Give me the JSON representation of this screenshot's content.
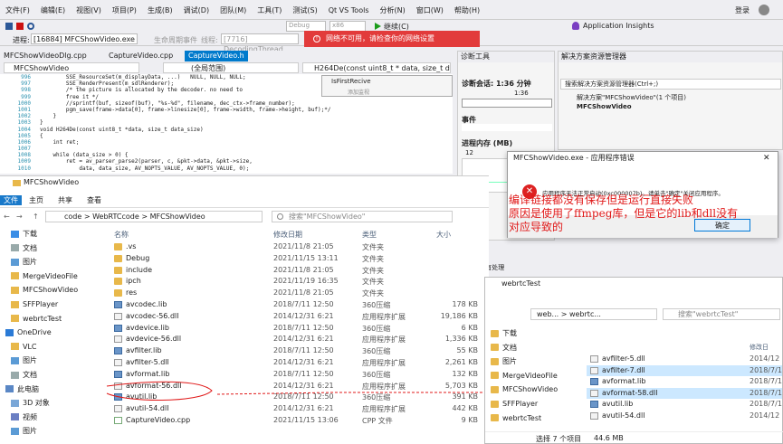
{
  "vs": {
    "menu": [
      "文件(F)",
      "编辑(E)",
      "视图(V)",
      "项目(P)",
      "生成(B)",
      "调试(D)",
      "团队(M)",
      "工具(T)",
      "测试(S)",
      "Qt VS Tools",
      "分析(N)",
      "窗口(W)",
      "帮助(H)"
    ],
    "login": "登录",
    "toolbar": {
      "config": "Debug",
      "platform": "x86",
      "continue": "继续(C)",
      "app_insights": "Application Insights"
    },
    "process_label": "进程:",
    "process_value": "[16884] MFCShowVideo.exe",
    "lifecycle": "生命周期事件",
    "thread_label": "线程:",
    "thread_value": "[7716] DecodingThread",
    "network_banner": "网络不可用，请检查你的网络设置",
    "tabs": [
      "MFCShowVideoDlg.cpp",
      "CaptureVideo.cpp",
      "CaptureVideo.h"
    ],
    "scope": "MFCShowVideo",
    "scope2": "(全局范围)",
    "func": "H264De(const uint8_t * data, size_t data_s",
    "code_lines": [
      {
        "num": "996",
        "text": "        SSE_ResourceSet(m_displayData, ...)   NULL, NULL, NULL;"
      },
      {
        "num": "997",
        "text": "        SSE_RenderPresent(m_sdlRenderer);"
      },
      {
        "num": "998",
        "text": "        /* the picture is allocated by the decoder. no need to"
      },
      {
        "num": "999",
        "text": "        free it */"
      },
      {
        "num": "1000",
        "text": "        //sprintf(buf, sizeof(buf), \"%s-%d\", filename, dec_ctx->frame_number);"
      },
      {
        "num": "1001",
        "text": "        pgm_save(frame->data[0], frame->linesize[0], frame->width, frame->height, buf);*/"
      },
      {
        "num": "1002",
        "text": "    }"
      },
      {
        "num": "1003",
        "text": "}"
      },
      {
        "num": "1004",
        "text": "void H264De(const uint8_t *data, size_t data_size)"
      },
      {
        "num": "1005",
        "text": "{"
      },
      {
        "num": "1006",
        "text": "    int ret;"
      },
      {
        "num": "1007",
        "text": ""
      },
      {
        "num": "1008",
        "text": "    while (data_size > 0) {"
      },
      {
        "num": "1009",
        "text": "        ret = av_parser_parse2(parser, c, &pkt->data, &pkt->size,"
      },
      {
        "num": "1010",
        "text": "            data, data_size, AV_NOPTS_VALUE, AV_NOPTS_VALUE, 0);"
      }
    ],
    "popup_title": "IsFirstRecive",
    "popup_sub": "添加监视",
    "diag": {
      "title": "诊断工具",
      "session": "诊断会话: 1:36 分钟",
      "tick": "1:36",
      "events": "事件",
      "memory": "进程内存 (MB)",
      "mem_val": "12",
      "mem_val2": "0",
      "cpu": "CPU (所有处理",
      "snap": "快照",
      "use": "使用",
      "small": "最小大小(堆)"
    },
    "sol": {
      "title": "解决方案资源管理器",
      "search": "搜索解决方案资源管理器(Ctrl+;)",
      "item1": "解决方案\"MFCShowVideo\"(1 个项目)",
      "item2": "MFCShowVideo"
    }
  },
  "error": {
    "title": "MFCShowVideo.exe - 应用程序错误",
    "message": "应用程序无法正常启动(0xc000007b)。请单击\"确定\"关闭应用程序。",
    "ok": "确定"
  },
  "annotation": {
    "line1": "编译链接都没有保存但是运行直接失败",
    "line2": "原因是使用了ffmpeg库，但是它的lib和dll没有",
    "line3": "对应导致的"
  },
  "exp1": {
    "title": "MFCShowVideo",
    "ribbon": [
      "文件",
      "主页",
      "共享",
      "查看"
    ],
    "breadcrumb": [
      "code",
      "WebRTCcode",
      "MFCShowVideo"
    ],
    "search": "搜索\"MFCShowVideo\"",
    "headers": {
      "name": "名称",
      "date": "修改日期",
      "type": "类型",
      "size": "大小"
    },
    "nav": [
      {
        "label": "下载",
        "icon": "download-icon"
      },
      {
        "label": "文档",
        "icon": "document-icon"
      },
      {
        "label": "图片",
        "icon": "picture-icon"
      },
      {
        "label": "MergeVideoFile",
        "icon": "folder-icon"
      },
      {
        "label": "MFCShowVideo",
        "icon": "folder-icon"
      },
      {
        "label": "SFFPlayer",
        "icon": "folder-icon"
      },
      {
        "label": "webrtcTest",
        "icon": "folder-icon"
      },
      {
        "label": "OneDrive",
        "icon": "cloud-icon"
      },
      {
        "label": "VLC",
        "icon": "folder-icon"
      },
      {
        "label": "图片",
        "icon": "picture-icon"
      },
      {
        "label": "文档",
        "icon": "document-icon"
      },
      {
        "label": "此电脑",
        "icon": "pc-icon"
      },
      {
        "label": "3D 对象",
        "icon": "cube-icon"
      },
      {
        "label": "视频",
        "icon": "video-icon"
      },
      {
        "label": "图片",
        "icon": "picture-icon"
      }
    ],
    "files": [
      {
        "name": ".vs",
        "date": "2021/11/8 21:05",
        "type": "文件夹",
        "size": "",
        "kind": "folder"
      },
      {
        "name": "Debug",
        "date": "2021/11/15 13:11",
        "type": "文件夹",
        "size": "",
        "kind": "folder"
      },
      {
        "name": "include",
        "date": "2021/11/8 21:05",
        "type": "文件夹",
        "size": "",
        "kind": "folder"
      },
      {
        "name": "ipch",
        "date": "2021/11/19 16:35",
        "type": "文件夹",
        "size": "",
        "kind": "folder"
      },
      {
        "name": "res",
        "date": "2021/11/8 21:05",
        "type": "文件夹",
        "size": "",
        "kind": "folder"
      },
      {
        "name": "avcodec.lib",
        "date": "2018/7/11 12:50",
        "type": "360压缩",
        "size": "178 KB",
        "kind": "lib"
      },
      {
        "name": "avcodec-56.dll",
        "date": "2014/12/31 6:21",
        "type": "应用程序扩展",
        "size": "19,186 KB",
        "kind": "dll"
      },
      {
        "name": "avdevice.lib",
        "date": "2018/7/11 12:50",
        "type": "360压缩",
        "size": "6 KB",
        "kind": "lib"
      },
      {
        "name": "avdevice-56.dll",
        "date": "2014/12/31 6:21",
        "type": "应用程序扩展",
        "size": "1,336 KB",
        "kind": "dll"
      },
      {
        "name": "avfilter.lib",
        "date": "2018/7/11 12:50",
        "type": "360压缩",
        "size": "55 KB",
        "kind": "lib"
      },
      {
        "name": "avfilter-5.dll",
        "date": "2014/12/31 6:21",
        "type": "应用程序扩展",
        "size": "2,261 KB",
        "kind": "dll"
      },
      {
        "name": "avformat.lib",
        "date": "2018/7/11 12:50",
        "type": "360压缩",
        "size": "132 KB",
        "kind": "lib"
      },
      {
        "name": "avformat-56.dll",
        "date": "2014/12/31 6:21",
        "type": "应用程序扩展",
        "size": "5,703 KB",
        "kind": "dll"
      },
      {
        "name": "avutil.lib",
        "date": "2018/7/11 12:50",
        "type": "360压缩",
        "size": "391 KB",
        "kind": "lib"
      },
      {
        "name": "avutil-54.dll",
        "date": "2014/12/31 6:21",
        "type": "应用程序扩展",
        "size": "442 KB",
        "kind": "dll"
      },
      {
        "name": "CaptureVideo.cpp",
        "date": "2021/11/15 13:06",
        "type": "CPP 文件",
        "size": "9 KB",
        "kind": "cpp"
      }
    ]
  },
  "exp2": {
    "title": "webrtcTest",
    "breadcrumb": [
      "web...",
      "webrtc..."
    ],
    "search": "搜索\"webrtcTest\"",
    "header_date": "修改日",
    "nav": [
      "下载",
      "文档",
      "图片",
      "MergeVideoFile",
      "MFCShowVideo",
      "SFFPlayer",
      "webrtcTest"
    ],
    "files": [
      {
        "name": "avfilter-5.dll",
        "date": "2014/12",
        "kind": "dll"
      },
      {
        "name": "avfilter-7.dll",
        "date": "2018/7/1",
        "kind": "dll"
      },
      {
        "name": "avformat.lib",
        "date": "2018/7/1",
        "kind": "lib"
      },
      {
        "name": "avformat-58.dll",
        "date": "2018/7/1",
        "kind": "dll"
      },
      {
        "name": "avutil.lib",
        "date": "2018/7/1",
        "kind": "lib"
      },
      {
        "name": "avutil-54.dll",
        "date": "2014/12",
        "kind": "dll"
      }
    ],
    "status_count": "选择 7 个项目",
    "status_size": "44.6 MB"
  }
}
